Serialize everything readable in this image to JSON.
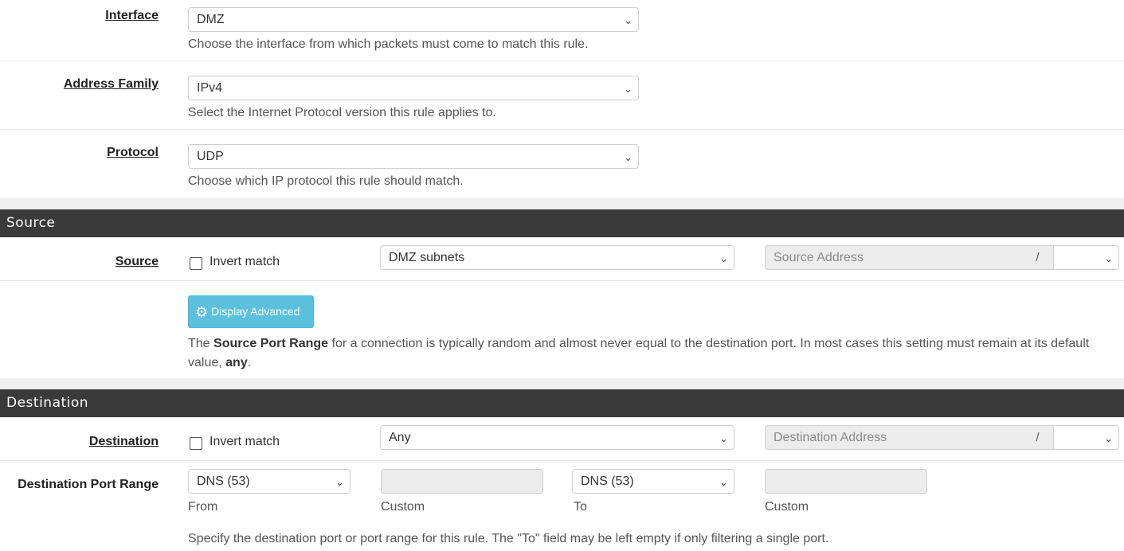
{
  "interface": {
    "label": "Interface",
    "value": "DMZ",
    "help": "Choose the interface from which packets must come to match this rule."
  },
  "address_family": {
    "label": "Address Family",
    "value": "IPv4",
    "help": "Select the Internet Protocol version this rule applies to."
  },
  "protocol": {
    "label": "Protocol",
    "value": "UDP",
    "help": "Choose which IP protocol this rule should match."
  },
  "source_section": {
    "title": "Source",
    "label": "Source",
    "invert_label": "Invert match",
    "type_value": "DMZ subnets",
    "address_placeholder": "Source Address",
    "slash": "/",
    "advanced_button": "Display Advanced",
    "help_prefix": "The ",
    "help_bold": "Source Port Range",
    "help_mid": " for a connection is typically random and almost never equal to the destination port. In most cases this setting must remain at its default value, ",
    "help_any": "any",
    "help_end": "."
  },
  "destination_section": {
    "title": "Destination",
    "label": "Destination",
    "invert_label": "Invert match",
    "type_value": "Any",
    "address_placeholder": "Destination Address",
    "slash": "/",
    "port_range_label": "Destination Port Range",
    "from_value": "DNS (53)",
    "to_value": "DNS (53)",
    "from_label": "From",
    "custom_label": "Custom",
    "to_label": "To",
    "custom_label2": "Custom",
    "help": "Specify the destination port or port range for this rule. The \"To\" field may be left empty if only filtering a single port."
  },
  "icons": {
    "chevron": "chevron-down-icon",
    "gear": "gear-icon"
  },
  "colors": {
    "section_header_bg": "#3a3a3a",
    "advanced_button_bg": "#5bc0de"
  }
}
